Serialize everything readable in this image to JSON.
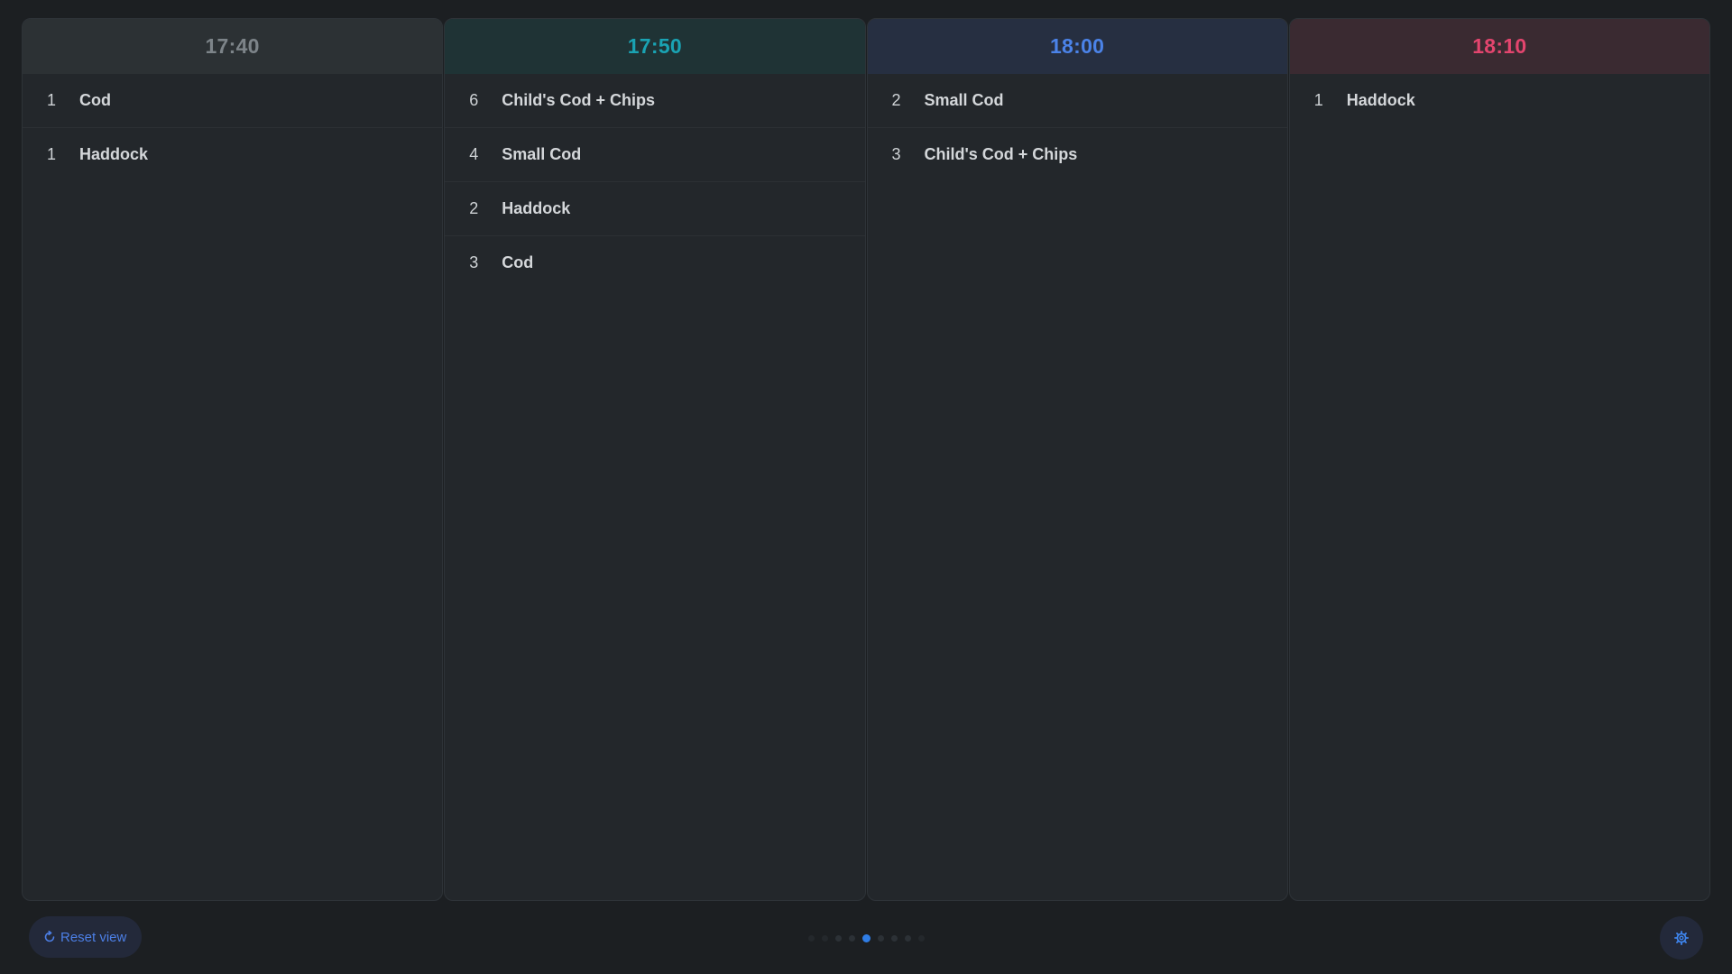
{
  "columns": [
    {
      "time": "17:40",
      "head_bg": "#2c3134",
      "head_color": "#7d8489",
      "items": [
        {
          "qty": "1",
          "name": "Cod"
        },
        {
          "qty": "1",
          "name": "Haddock"
        }
      ]
    },
    {
      "time": "17:50",
      "head_bg": "#1f3335",
      "head_color": "#1aa3b3",
      "items": [
        {
          "qty": "6",
          "name": "Child's Cod + Chips"
        },
        {
          "qty": "4",
          "name": "Small Cod"
        },
        {
          "qty": "2",
          "name": "Haddock"
        },
        {
          "qty": "3",
          "name": "Cod"
        }
      ]
    },
    {
      "time": "18:00",
      "head_bg": "#262f41",
      "head_color": "#4b83e8",
      "items": [
        {
          "qty": "2",
          "name": "Small Cod"
        },
        {
          "qty": "3",
          "name": "Child's Cod + Chips"
        }
      ]
    },
    {
      "time": "18:10",
      "head_bg": "#3a2a31",
      "head_color": "#e3456e",
      "items": [
        {
          "qty": "1",
          "name": "Haddock"
        }
      ]
    }
  ],
  "footer": {
    "reset_label": "Reset view",
    "reset_icon": "refresh-icon",
    "settings_icon": "gear-icon",
    "accent": "#2f7de6",
    "pager": {
      "count": 9,
      "active_index": 4
    }
  }
}
